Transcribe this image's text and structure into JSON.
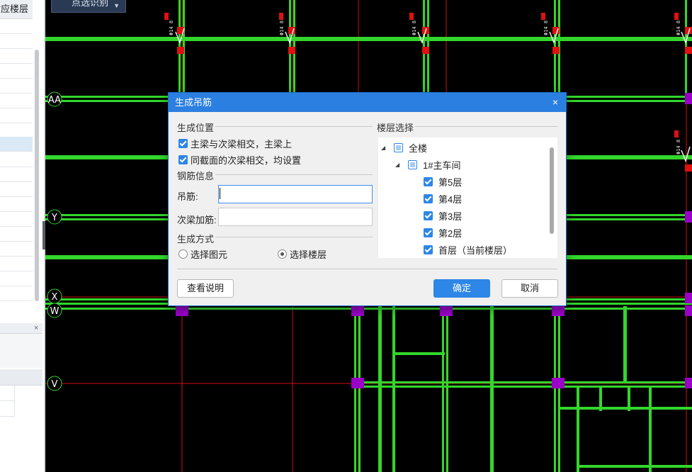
{
  "left_panel": {
    "header_label": "对应楼层",
    "bottom_close": "×"
  },
  "top_button": {
    "label": "点选识别",
    "arrow": "▼"
  },
  "axes": {
    "labels": [
      "AA",
      "Y",
      "X",
      "W",
      "V"
    ],
    "beam_tag": "Φ14 8"
  },
  "dialog": {
    "title": "生成吊筋",
    "close": "×",
    "position_section": {
      "label": "生成位置",
      "options": [
        {
          "label": "主梁与次梁相交，主梁上",
          "checked": true
        },
        {
          "label": "同截面的次梁相交，均设置",
          "checked": true
        }
      ]
    },
    "rebar_section": {
      "label": "钢筋信息",
      "hanger_label": "吊筋:",
      "hanger_value": "",
      "secondary_label": "次梁加筋:",
      "secondary_value": ""
    },
    "method_section": {
      "label": "生成方式",
      "options": [
        {
          "label": "选择图元",
          "selected": false
        },
        {
          "label": "选择楼层",
          "selected": true
        }
      ]
    },
    "floor_section": {
      "label": "楼层选择",
      "root": {
        "label": "全楼",
        "expander": "◢",
        "state": "partial"
      },
      "building": {
        "label": "1#主车间",
        "expander": "◢",
        "state": "partial"
      },
      "floors": [
        {
          "label": "第5层",
          "checked": true
        },
        {
          "label": "第4层",
          "checked": true
        },
        {
          "label": "第3层",
          "checked": true
        },
        {
          "label": "第2层",
          "checked": true
        },
        {
          "label": "首层（当前楼层）",
          "checked": true
        }
      ]
    },
    "buttons": {
      "help": "查看说明",
      "ok": "确定",
      "cancel": "取消"
    }
  },
  "colors": {
    "beam_green": "#33d62c",
    "column_purple": "#9a00c8",
    "column_red": "#e01010",
    "grid_red": "#d01010",
    "dialog_blue": "#2b7fe0"
  }
}
